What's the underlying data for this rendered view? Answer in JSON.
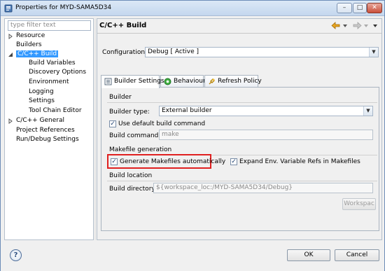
{
  "window": {
    "title": "Properties for MYD-SAMA5D34",
    "min_icon": "minimize-icon",
    "max_icon": "maximize-icon",
    "close_icon": "close-icon"
  },
  "sidebar": {
    "filter_placeholder": "type filter text",
    "items": [
      {
        "label": "Resource",
        "expandable": true,
        "expanded": false
      },
      {
        "label": "Builders",
        "expandable": false
      },
      {
        "label": "C/C++ Build",
        "expandable": true,
        "expanded": true,
        "selected": true
      },
      {
        "label": "Build Variables",
        "child": true
      },
      {
        "label": "Discovery Options",
        "child": true
      },
      {
        "label": "Environment",
        "child": true
      },
      {
        "label": "Logging",
        "child": true
      },
      {
        "label": "Settings",
        "child": true
      },
      {
        "label": "Tool Chain Editor",
        "child": true
      },
      {
        "label": "C/C++ General",
        "expandable": true,
        "expanded": false
      },
      {
        "label": "Project References",
        "expandable": false
      },
      {
        "label": "Run/Debug Settings",
        "expandable": false
      }
    ]
  },
  "main": {
    "title": "C/C++ Build",
    "configuration_label": "Configuration:",
    "configuration_value": "Debug  [ Active ]",
    "tabs": [
      {
        "label": "Builder Settings",
        "active": true
      },
      {
        "label": "Behaviour",
        "active": false
      },
      {
        "label": "Refresh Policy",
        "active": false
      }
    ],
    "builder": {
      "group_title": "Builder",
      "type_label": "Builder type:",
      "type_value": "External builder",
      "use_default_label": "Use default build command",
      "use_default_checked": true,
      "command_label": "Build command:",
      "command_value": "make"
    },
    "makefile": {
      "group_title": "Makefile generation",
      "generate_label": "Generate Makefiles automatically",
      "generate_checked": true,
      "expand_label": "Expand Env. Variable Refs in Makefiles",
      "expand_checked": true
    },
    "location": {
      "group_title": "Build location",
      "dir_label": "Build directory:",
      "dir_value": "${workspace_loc:/MYD-SAMA5D34/Debug}",
      "workspace_button": "Workspac"
    }
  },
  "footer": {
    "ok": "OK",
    "cancel": "Cancel"
  },
  "colors": {
    "selection": "#3399ff",
    "highlight_box": "#e02020"
  }
}
